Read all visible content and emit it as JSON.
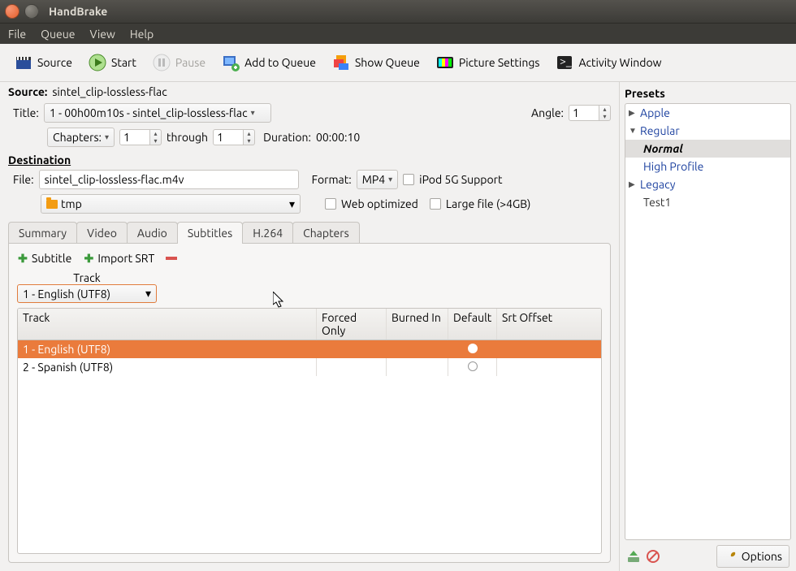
{
  "window": {
    "title": "HandBrake"
  },
  "menu": {
    "file": "File",
    "queue": "Queue",
    "view": "View",
    "help": "Help"
  },
  "toolbar": {
    "source": "Source",
    "start": "Start",
    "pause": "Pause",
    "addqueue": "Add to Queue",
    "showqueue": "Show Queue",
    "picture": "Picture Settings",
    "activity": "Activity Window"
  },
  "source": {
    "label": "Source:",
    "value": "sintel_clip-lossless-flac",
    "title_label": "Title:",
    "title_value": "1 - 00h00m10s - sintel_clip-lossless-flac",
    "angle_label": "Angle:",
    "angle_value": "1",
    "chapters_label": "Chapters:",
    "ch_from": "1",
    "through": "through",
    "ch_to": "1",
    "duration_label": "Duration:",
    "duration_value": "00:00:10"
  },
  "dest": {
    "header": "Destination",
    "file_label": "File:",
    "file_value": "sintel_clip-lossless-flac.m4v",
    "folder": "tmp",
    "format_label": "Format:",
    "format_value": "MP4",
    "ipod": "iPod 5G Support",
    "web": "Web optimized",
    "large": "Large file (>4GB)"
  },
  "tabs": {
    "summary": "Summary",
    "video": "Video",
    "audio": "Audio",
    "subtitles": "Subtitles",
    "h264": "H.264",
    "chapters": "Chapters"
  },
  "sub": {
    "add": "Subtitle",
    "import": "Import SRT",
    "track_label": "Track",
    "track_value": "1 - English (UTF8)",
    "cols": {
      "track": "Track",
      "forced": "Forced Only",
      "burned": "Burned In",
      "default": "Default",
      "offset": "Srt Offset"
    },
    "rows": [
      {
        "track": "1 - English (UTF8)",
        "default": true
      },
      {
        "track": "2 - Spanish (UTF8)",
        "default": false
      }
    ]
  },
  "presets": {
    "header": "Presets",
    "apple": "Apple",
    "regular": "Regular",
    "normal": "Normal",
    "high": "High Profile",
    "legacy": "Legacy",
    "test1": "Test1"
  },
  "options": "Options"
}
